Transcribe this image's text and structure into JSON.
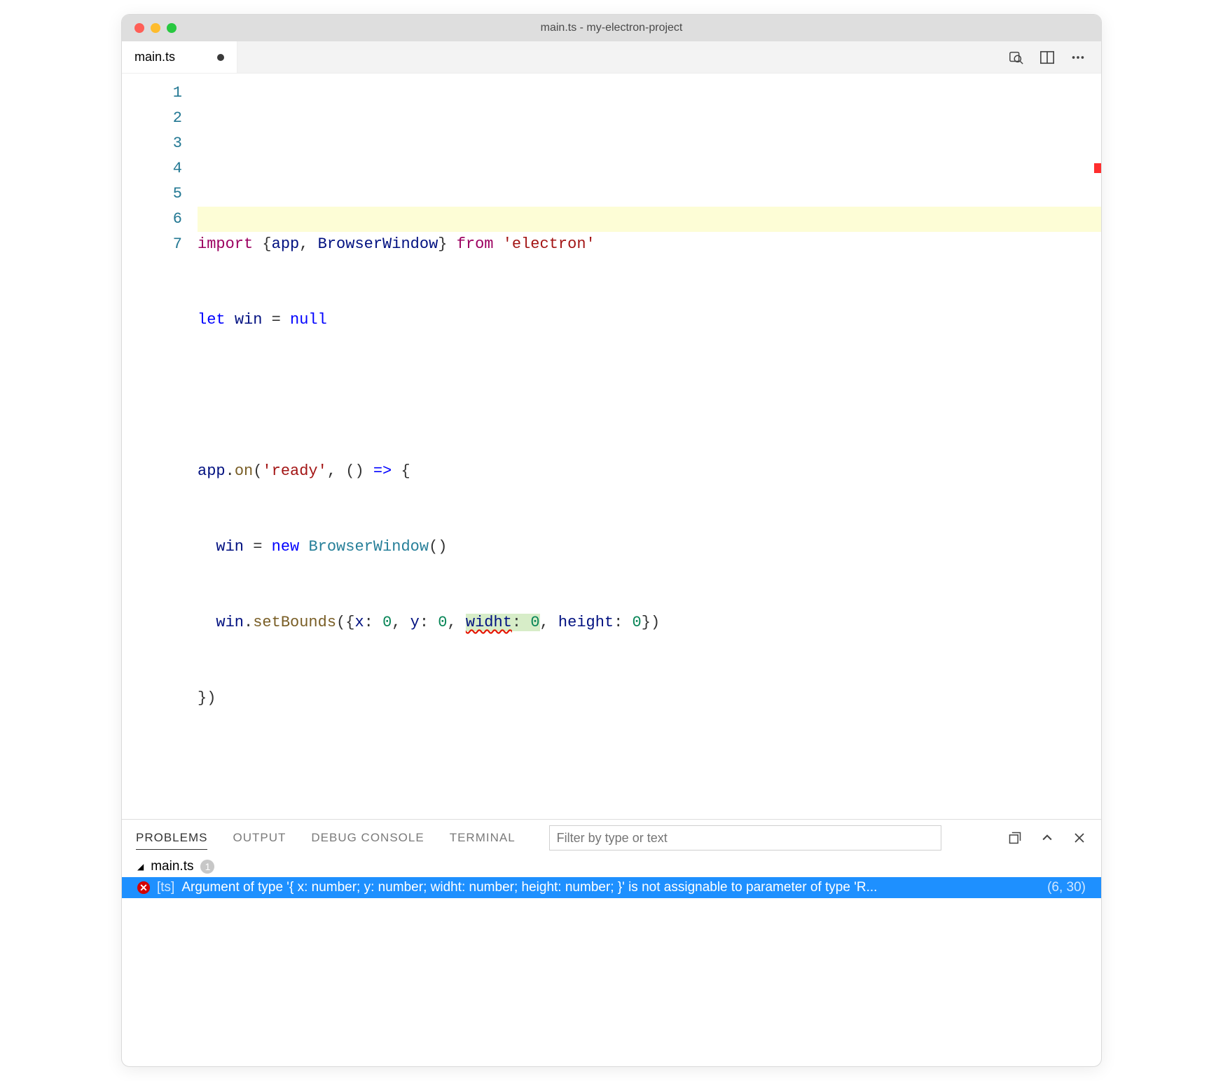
{
  "window": {
    "title": "main.ts - my-electron-project"
  },
  "tab": {
    "filename": "main.ts",
    "dirty": true
  },
  "toolbar": {},
  "editor": {
    "highlighted_line_index": 5,
    "line_numbers": [
      "1",
      "2",
      "3",
      "4",
      "5",
      "6",
      "7"
    ],
    "tokens": {
      "l1": {
        "import": "import",
        "lb": "{",
        "app": "app",
        "comma": ", ",
        "bw": "BrowserWindow",
        "rb": "}",
        "from": "from",
        "str": "'electron'"
      },
      "l2": {
        "let": "let",
        "win": "win ",
        "eq": "= ",
        "null": "null"
      },
      "l4": {
        "app": "app",
        "dot": ".",
        "on": "on",
        "lp": "(",
        "str": "'ready'",
        "comma": ", () ",
        "arrow": "=>",
        "brace": " {"
      },
      "l5": {
        "indent": "  ",
        "win": "win ",
        "eq": "= ",
        "new": "new",
        "sp": " ",
        "bw": "BrowserWindow",
        "paren": "()"
      },
      "l6": {
        "indent": "  ",
        "win": "win",
        "dot": ".",
        "fn": "setBounds",
        "open": "({",
        "x": "x",
        "colon1": ": ",
        "n0a": "0",
        "c1": ", ",
        "y": "y",
        "colon2": ": ",
        "n0b": "0",
        "c2": ", ",
        "widht": "widht",
        "colon3": ": ",
        "n0c": "0",
        "c3": ", ",
        "height": "height",
        "colon4": ": ",
        "n0d": "0",
        "close": "})"
      },
      "l7": {
        "text": "})"
      }
    }
  },
  "panel": {
    "tabs": {
      "problems": "PROBLEMS",
      "output": "OUTPUT",
      "debug": "DEBUG CONSOLE",
      "terminal": "TERMINAL"
    },
    "filter_placeholder": "Filter by type or text",
    "file": {
      "name": "main.ts",
      "count": "1"
    },
    "error": {
      "tag": "[ts]",
      "message": "Argument of type '{ x: number; y: number; widht: number; height: number; }' is not assignable to parameter of type 'R...",
      "location": "(6, 30)"
    }
  }
}
